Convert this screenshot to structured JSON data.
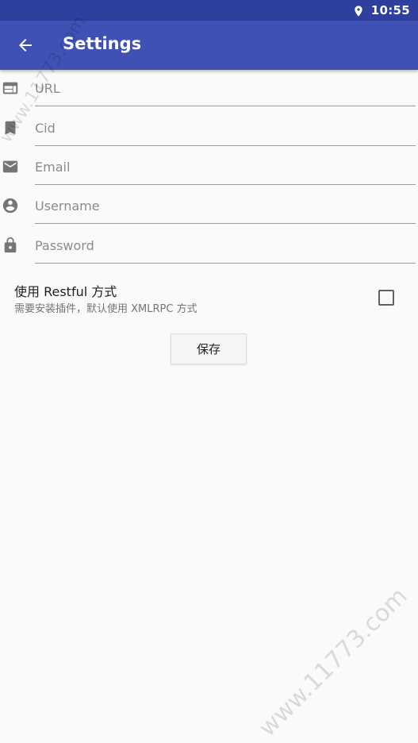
{
  "status_bar": {
    "time": "10:55",
    "location_icon": "location-pin-icon"
  },
  "app_bar": {
    "title": "Settings",
    "back_icon": "arrow-back-icon"
  },
  "fields": [
    {
      "name": "url",
      "placeholder": "URL",
      "value": "",
      "icon": "web-icon"
    },
    {
      "name": "cid",
      "placeholder": "Cid",
      "value": "",
      "icon": "bookmark-icon"
    },
    {
      "name": "email",
      "placeholder": "Email",
      "value": "",
      "icon": "email-icon"
    },
    {
      "name": "username",
      "placeholder": "Username",
      "value": "",
      "icon": "account-circle-icon"
    },
    {
      "name": "password",
      "placeholder": "Password",
      "value": "",
      "icon": "lock-icon"
    }
  ],
  "restful_option": {
    "title": "使用 Restful 方式",
    "subtitle": "需要安装插件，默认使用 XMLRPC 方式",
    "checked": false
  },
  "save_button": {
    "label": "保存"
  },
  "watermark": {
    "text": "www.11773.com"
  },
  "colors": {
    "app_bar": "#3f51b5",
    "status_bar": "#2f3f9e",
    "background": "#fafafa",
    "icon": "#757575"
  }
}
